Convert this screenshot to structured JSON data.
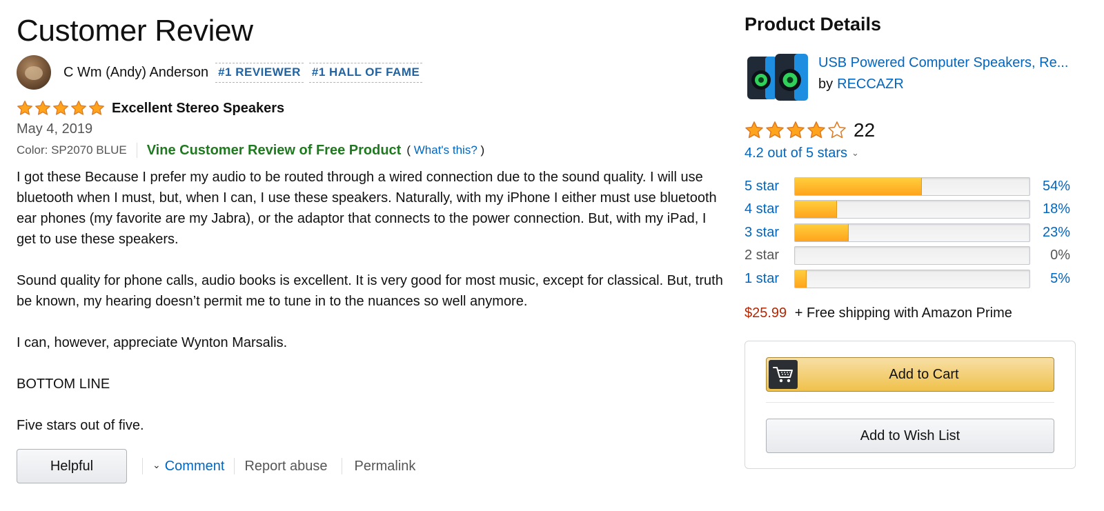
{
  "review": {
    "page_title": "Customer Review",
    "reviewer": {
      "name": "C Wm (Andy) Anderson",
      "badges": [
        "#1 REVIEWER",
        "#1 HALL OF FAME"
      ]
    },
    "rating": 5,
    "title": "Excellent Stereo Speakers",
    "date": "May 4, 2019",
    "color_label": "Color: SP2070 BLUE",
    "vine_label": "Vine Customer Review of Free Product",
    "whats_this": {
      "open": "(",
      "link": "What's this?",
      "close": ")"
    },
    "body": [
      "I got these Because I prefer my audio to be routed through a wired connection due to the sound quality. I will use bluetooth when I must, but, when I can, I use these speakers. Naturally, with my iPhone I either must use bluetooth ear phones (my favorite are my Jabra), or the adaptor that connects to the power connection. But, with my iPad, I get to use these speakers.",
      "Sound quality for phone calls, audio books is excellent. It is very good for most music, except for classical. But, truth be known, my hearing doesn’t permit me to tune in to the nuances so well anymore.",
      "I can, however, appreciate Wynton Marsalis.",
      "BOTTOM LINE",
      "Five stars out of five."
    ],
    "actions": {
      "helpful": "Helpful",
      "comment": "Comment",
      "report": "Report abuse",
      "permalink": "Permalink"
    }
  },
  "product": {
    "section_title": "Product Details",
    "name": "USB Powered Computer Speakers, Re...",
    "by_label": "by",
    "brand": "RECCAZR",
    "avg_rating": 4.2,
    "rating_count": "22",
    "avg_text": "4.2 out of 5 stars",
    "histogram": [
      {
        "label": "5 star",
        "percent": 54,
        "percent_text": "54%"
      },
      {
        "label": "4 star",
        "percent": 18,
        "percent_text": "18%"
      },
      {
        "label": "3 star",
        "percent": 23,
        "percent_text": "23%"
      },
      {
        "label": "2 star",
        "percent": 0,
        "percent_text": "0%"
      },
      {
        "label": "1 star",
        "percent": 5,
        "percent_text": "5%"
      }
    ],
    "price": "$25.99",
    "shipping": "+ Free shipping with Amazon Prime",
    "add_to_cart": "Add to Cart",
    "add_to_wish_list": "Add to Wish List"
  },
  "colors": {
    "link": "#0066c0",
    "vine_green": "#1f7a1f",
    "price_red": "#b12704",
    "star_gold": "#ffa41c",
    "badge_blue": "#2162a1"
  },
  "icons": {
    "cart": "cart-icon",
    "chevron": "chevron-down-icon",
    "star": "star-icon"
  }
}
